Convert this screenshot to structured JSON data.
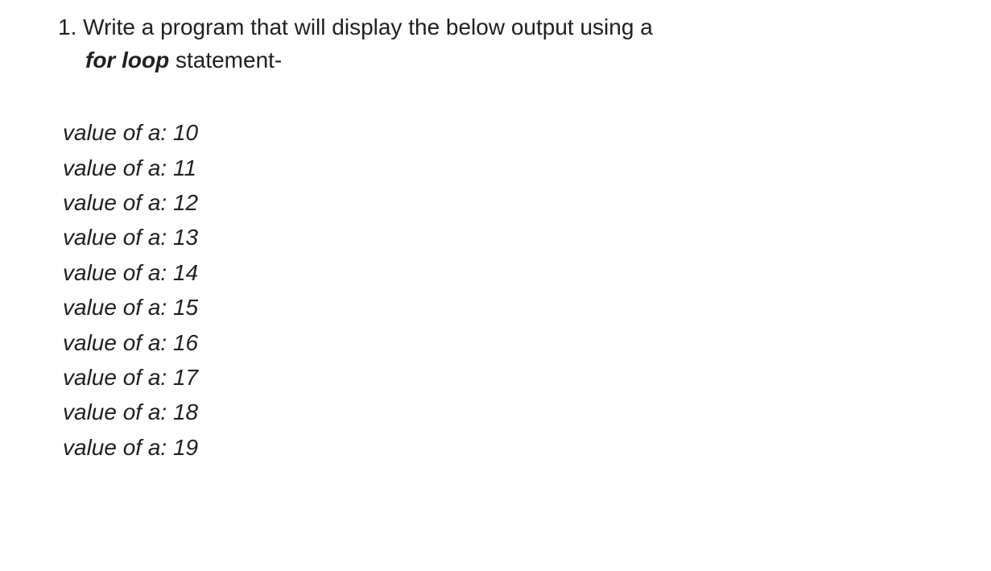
{
  "question": {
    "number": "1.",
    "text_before": "Write a program that will display the below output using a",
    "keyword": "for loop",
    "text_after": " statement-"
  },
  "output": {
    "prefix": "value of a: ",
    "values": [
      "10",
      "11",
      "12",
      "13",
      "14",
      "15",
      "16",
      "17",
      "18",
      "19"
    ]
  }
}
